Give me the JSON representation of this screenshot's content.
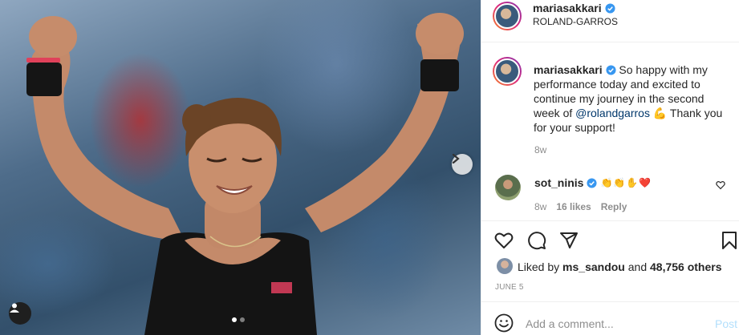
{
  "post": {
    "username": "mariasakkari",
    "location": "ROLAND-GARROS",
    "caption": {
      "username": "mariasakkari",
      "text_before": " So happy with my performance today and excited to continue my journey in the second week of ",
      "mention": "@rolandgarros",
      "emoji": "💪",
      "text_after": " Thank you for your support!",
      "time": "8w"
    },
    "comment": {
      "username": "sot_ninis",
      "emoji": [
        "👏",
        "👏",
        "✋",
        "❤️"
      ],
      "time": "8w",
      "likes": "16 likes",
      "reply_label": "Reply"
    },
    "likes": {
      "prefix": "Liked by ",
      "liker": "ms_sandou",
      "middle": " and ",
      "count": "48,756 others"
    },
    "date": "JUNE 5",
    "add_comment": {
      "placeholder": "Add a comment...",
      "post_label": "Post"
    },
    "carousel": {
      "slides": 2,
      "active": 1
    },
    "colors": {
      "verified": "#3897f0",
      "link": "#00376b",
      "muted": "#8e8e8e",
      "post_disabled": "#b2dffc"
    },
    "icons": [
      "verified-icon",
      "heart-icon",
      "comment-icon",
      "share-icon",
      "bookmark-icon",
      "smile-icon",
      "chevron-right-icon",
      "tag-user-icon"
    ]
  }
}
